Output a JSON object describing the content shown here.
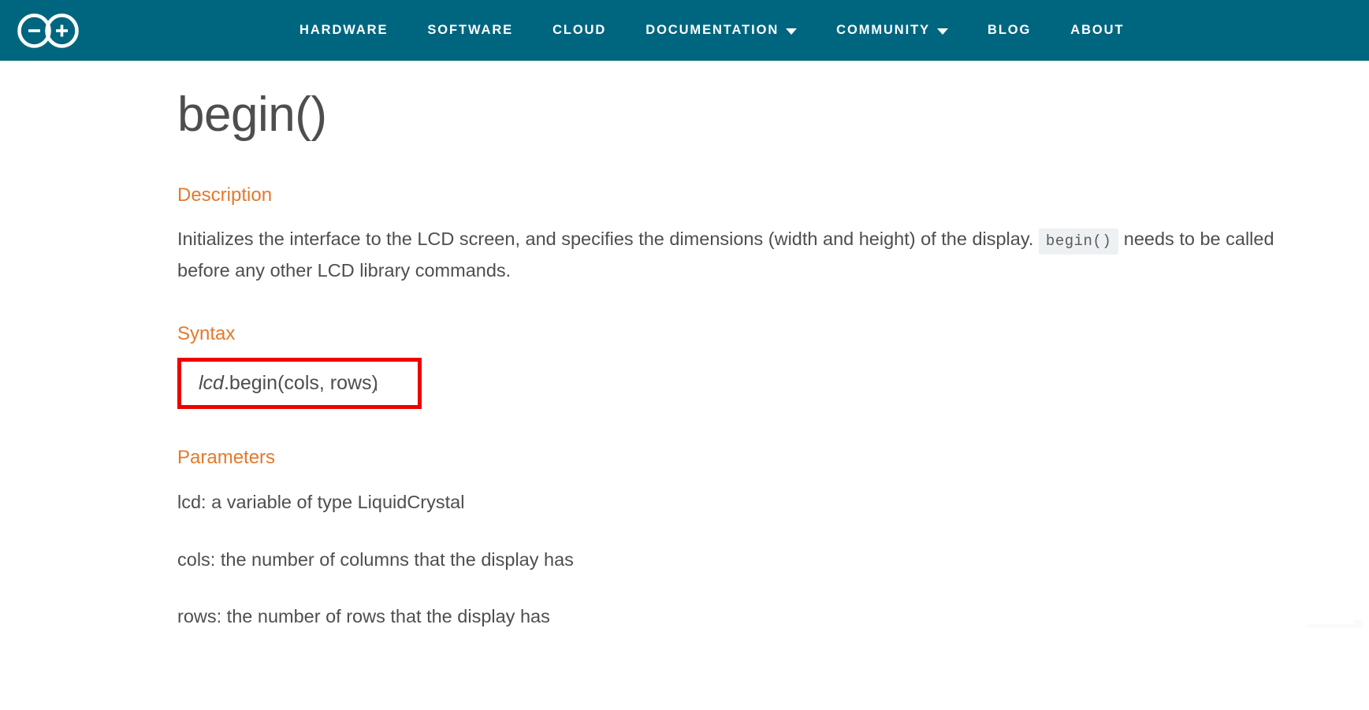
{
  "header": {
    "logo": {
      "icon": "arduino-infinity-logo",
      "alt": "Arduino"
    },
    "nav_items": [
      {
        "label": "HARDWARE",
        "has_dropdown": false
      },
      {
        "label": "SOFTWARE",
        "has_dropdown": false
      },
      {
        "label": "CLOUD",
        "has_dropdown": false
      },
      {
        "label": "DOCUMENTATION",
        "has_dropdown": true
      },
      {
        "label": "COMMUNITY",
        "has_dropdown": true
      },
      {
        "label": "BLOG",
        "has_dropdown": false
      },
      {
        "label": "ABOUT",
        "has_dropdown": false
      }
    ]
  },
  "page": {
    "title": "begin()",
    "description": {
      "heading": "Description",
      "text_before_code": "Initializes the interface to the LCD screen, and specifies the dimensions (width and height) of the display.",
      "inline_code": "begin()",
      "text_after_code": "needs to be called before any other LCD library commands."
    },
    "syntax": {
      "heading": "Syntax",
      "object": "lcd",
      "call": ".begin(cols, rows)",
      "full_text": "lcd.begin(cols, rows)",
      "highlight_color": "#ef0000"
    },
    "parameters": {
      "heading": "Parameters",
      "items": [
        "lcd: a variable of type LiquidCrystal",
        "cols: the number of columns that the display has",
        "rows: the number of rows that the display has"
      ]
    }
  },
  "colors": {
    "header_bg": "#006680",
    "heading_orange": "#e4792b",
    "body_text": "#4e4e4e",
    "code_bg": "#eef1f3",
    "highlight_red": "#ef0000"
  }
}
